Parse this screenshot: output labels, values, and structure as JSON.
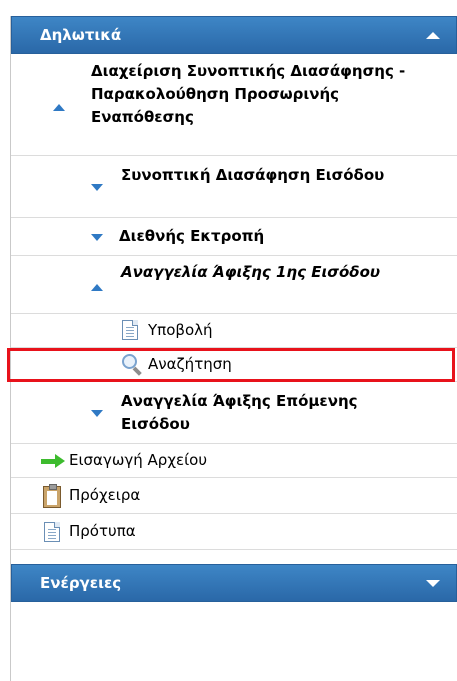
{
  "declarations_header": {
    "title": "Δηλωτικά",
    "toggle_icon": "chevron-up-icon"
  },
  "menu": {
    "summary_management": "Διαχείριση Συνοπτικής Διασάφησης - Παρακολούθηση Προσωρινής Εναπόθεσης",
    "summary_entry": "Συνοπτική Διασάφηση Εισόδου",
    "intl_diversion": "Διεθνής Εκτροπή",
    "arrival_notice_first": "Αναγγελία Άφιξης 1ης Εισόδου",
    "submit": "Υποβολή",
    "search": "Αναζήτηση",
    "arrival_notice_next": "Αναγγελία Άφιξης Επόμενης Εισόδου",
    "file_import": "Εισαγωγή Αρχείου",
    "drafts": "Πρόχειρα",
    "templates": "Πρότυπα"
  },
  "actions_header": {
    "title": "Ενέργειες",
    "toggle_icon": "chevron-down-icon"
  },
  "colors": {
    "header": "#2f74b7",
    "highlight": "#e8121b",
    "tree_arrow": "#2f79c4"
  }
}
